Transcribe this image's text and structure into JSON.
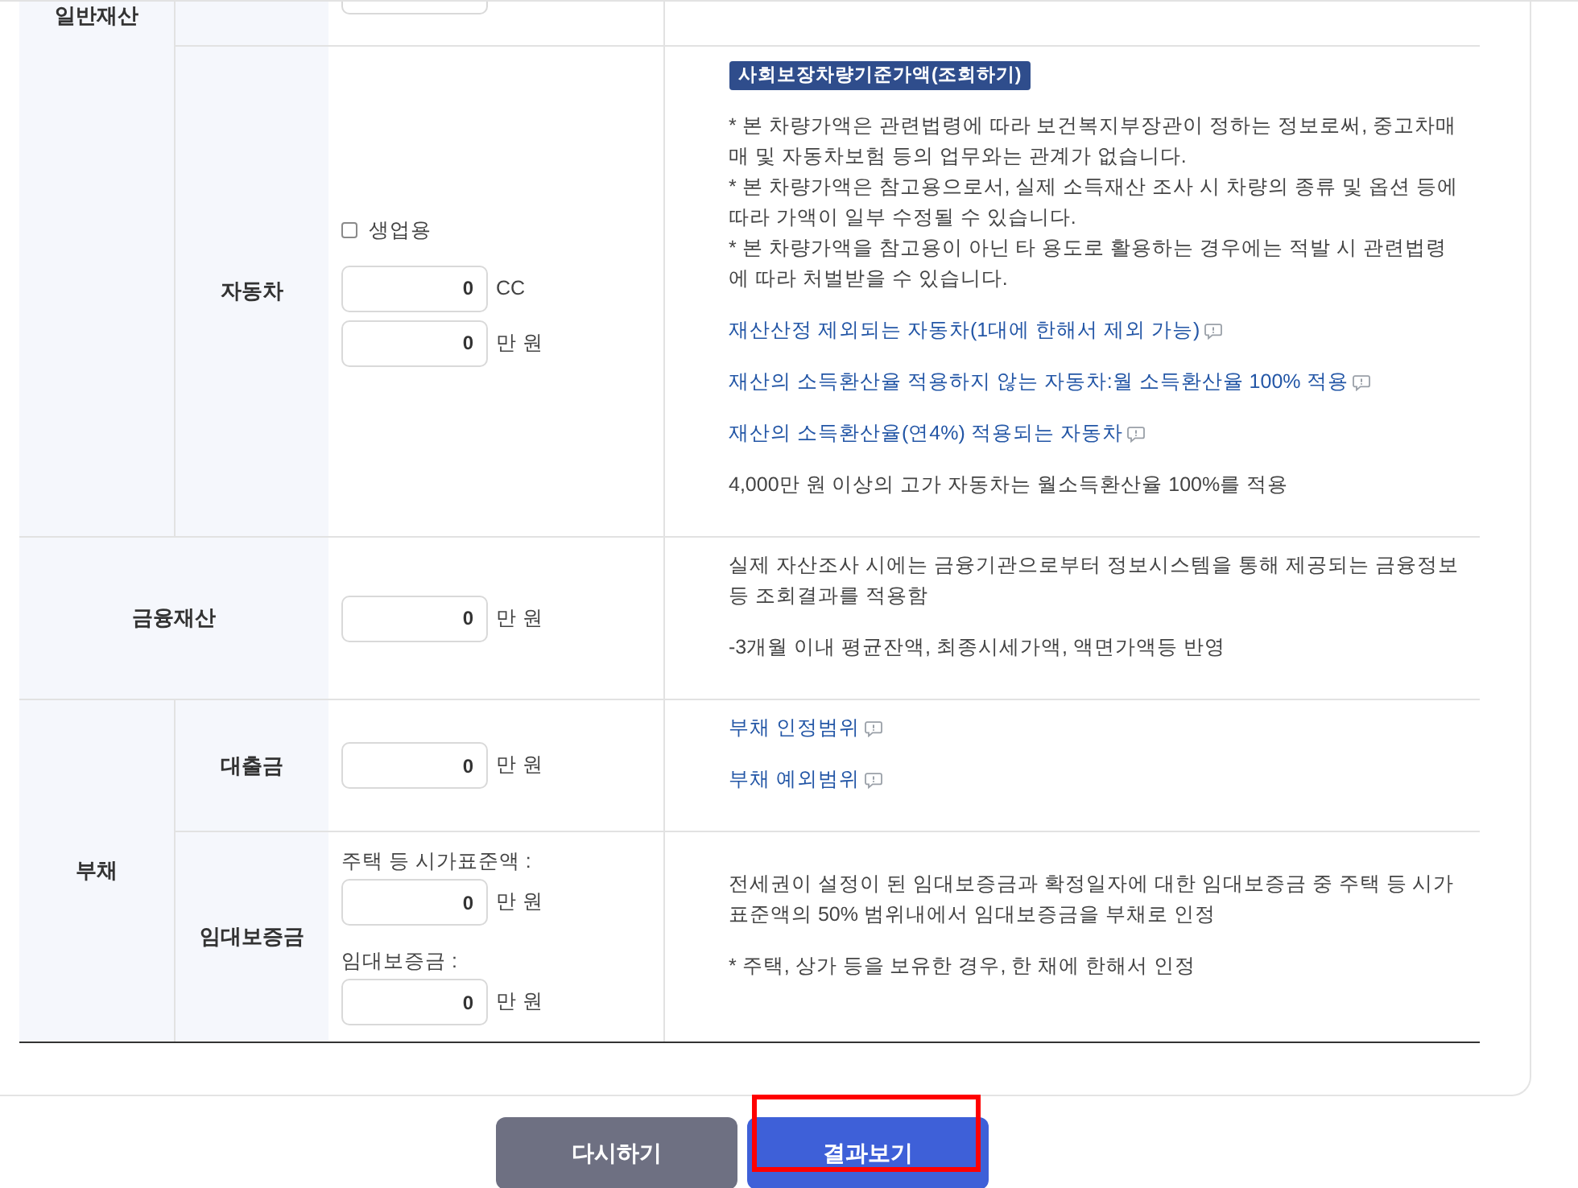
{
  "table": {
    "groups": [
      {
        "kind": "split",
        "label": "일반재산",
        "rows": [
          {
            "kind": "cut_off"
          },
          {
            "kind": "entry",
            "label": "자동차",
            "inputs": [
              {
                "kind": "checkbox",
                "label": "생업용",
                "checked": false
              },
              {
                "kind": "field",
                "value": "0",
                "unit": "CC"
              },
              {
                "kind": "field",
                "value": "0",
                "unit": "만 원"
              }
            ],
            "info": [
              {
                "kind": "badge",
                "text": "사회보장차량기준가액(조회하기)"
              },
              {
                "kind": "notes",
                "lines": [
                  "* 본 차량가액은 관련법령에 따라 보건복지부장관이 정하는 정보로써, 중고차매매 및 자동차보험 등의 업무와는 관계가 없습니다.",
                  "* 본 차량가액은 참고용으로서, 실제 소득재산 조사 시 차량의 종류 및 옵션 등에 따라 가액이 일부 수정될 수 있습니다.",
                  "* 본 차량가액을 참고용이 아닌 타 용도로 활용하는 경우에는 적발 시 관련법령에 따라 처벌받을 수 있습니다."
                ]
              },
              {
                "kind": "link",
                "text": "재산산정 제외되는 자동차(1대에 한해서 제외 가능)"
              },
              {
                "kind": "link",
                "text": "재산의 소득환산율 적용하지 않는 자동차:월 소득환산율 100% 적용"
              },
              {
                "kind": "link",
                "text": "재산의 소득환산율(연4%) 적용되는 자동차"
              },
              {
                "kind": "text",
                "text": "4,000만 원 이상의 고가 자동차는 월소득환산율 100%를 적용"
              }
            ]
          }
        ]
      },
      {
        "kind": "merged",
        "label": "금융재산",
        "rows": [
          {
            "kind": "entry",
            "inputs": [
              {
                "kind": "field",
                "value": "0",
                "unit": "만 원"
              }
            ],
            "info": [
              {
                "kind": "text",
                "text": "실제 자산조사 시에는 금융기관으로부터 정보시스템을 통해 제공되는 금융정보 등 조회결과를 적용함"
              },
              {
                "kind": "text",
                "text": "-3개월 이내 평균잔액, 최종시세가액, 액면가액등 반영"
              }
            ]
          }
        ]
      },
      {
        "kind": "split",
        "label": "부채",
        "rows": [
          {
            "kind": "entry",
            "label": "대출금",
            "inputs": [
              {
                "kind": "field",
                "value": "0",
                "unit": "만 원"
              }
            ],
            "info": [
              {
                "kind": "link",
                "text": "부채 인정범위"
              },
              {
                "kind": "link",
                "text": "부채 예외범위"
              }
            ]
          },
          {
            "kind": "entry",
            "label": "임대보증금",
            "inputs": [
              {
                "kind": "caption",
                "text": "주택 등 시가표준액 :"
              },
              {
                "kind": "field",
                "value": "0",
                "unit": "만 원"
              },
              {
                "kind": "caption",
                "text": "임대보증금 :"
              },
              {
                "kind": "field",
                "value": "0",
                "unit": "만 원"
              }
            ],
            "info": [
              {
                "kind": "text",
                "text": "전세권이 설정이 된 임대보증금과 확정일자에 대한 임대보증금 중 주택 등 시가표준액의 50% 범위내에서 임대보증금을 부채로 인정"
              },
              {
                "kind": "text",
                "text": "* 주택, 상가 등을 보유한 경우, 한 채에 한해서 인정"
              }
            ]
          }
        ]
      }
    ]
  },
  "buttons": [
    {
      "kind": "secondary",
      "label": "다시하기",
      "highlighted": false
    },
    {
      "kind": "primary",
      "label": "결과보기",
      "highlighted": true
    }
  ]
}
